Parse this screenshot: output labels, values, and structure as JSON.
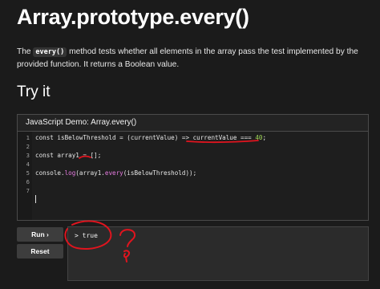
{
  "page": {
    "title": "Array.prototype.every()",
    "description": {
      "before": "The",
      "code": "every()",
      "after": "method tests whether all elements in the array pass the test implemented by the provided function. It returns a Boolean value."
    },
    "section_title": "Try it"
  },
  "demo": {
    "header": "JavaScript Demo: Array.every()",
    "line_numbers": [
      "1",
      "2",
      "3",
      "4",
      "5",
      "6",
      "7"
    ],
    "code": {
      "line1_a": "const isBelowThreshold = (currentValue) => currentValue === ",
      "line1_num": "40",
      "line1_end": ";",
      "line3": "const array1 = [];",
      "line5_a": "console.",
      "line5_log": "log",
      "line5_b": "(array1.",
      "line5_every": "every",
      "line5_c": "(isBelowThreshold));"
    }
  },
  "controls": {
    "run_label": "Run ›",
    "reset_label": "Reset"
  },
  "console": {
    "output": "> true"
  },
  "colors": {
    "background": "#1b1b1b",
    "annotation_red": "#e0141e",
    "function_token": "#e57be0",
    "number_token": "#a3d95a"
  }
}
